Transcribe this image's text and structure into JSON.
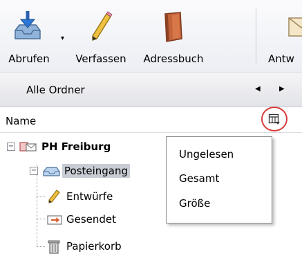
{
  "toolbar": {
    "buttons": [
      {
        "label": "Abrufen",
        "icon": "inbox-download-icon"
      },
      {
        "label": "Verfassen",
        "icon": "pencil-icon"
      },
      {
        "label": "Adressbuch",
        "icon": "address-book-icon"
      },
      {
        "label": "Antw",
        "icon": "reply-icon"
      }
    ]
  },
  "folder_bar": {
    "title": "Alle Ordner"
  },
  "column_header": {
    "name": "Name"
  },
  "tree": {
    "account": "PH Freiburg",
    "inbox": "Posteingang",
    "drafts": "Entwürfe",
    "sent": "Gesendet",
    "trash": "Papierkorb"
  },
  "popup_menu": {
    "items": [
      "Ungelesen",
      "Gesamt",
      "Größe"
    ]
  },
  "colors": {
    "accent_highlight": "#d63a3a",
    "selection": "#c8ccd4"
  }
}
